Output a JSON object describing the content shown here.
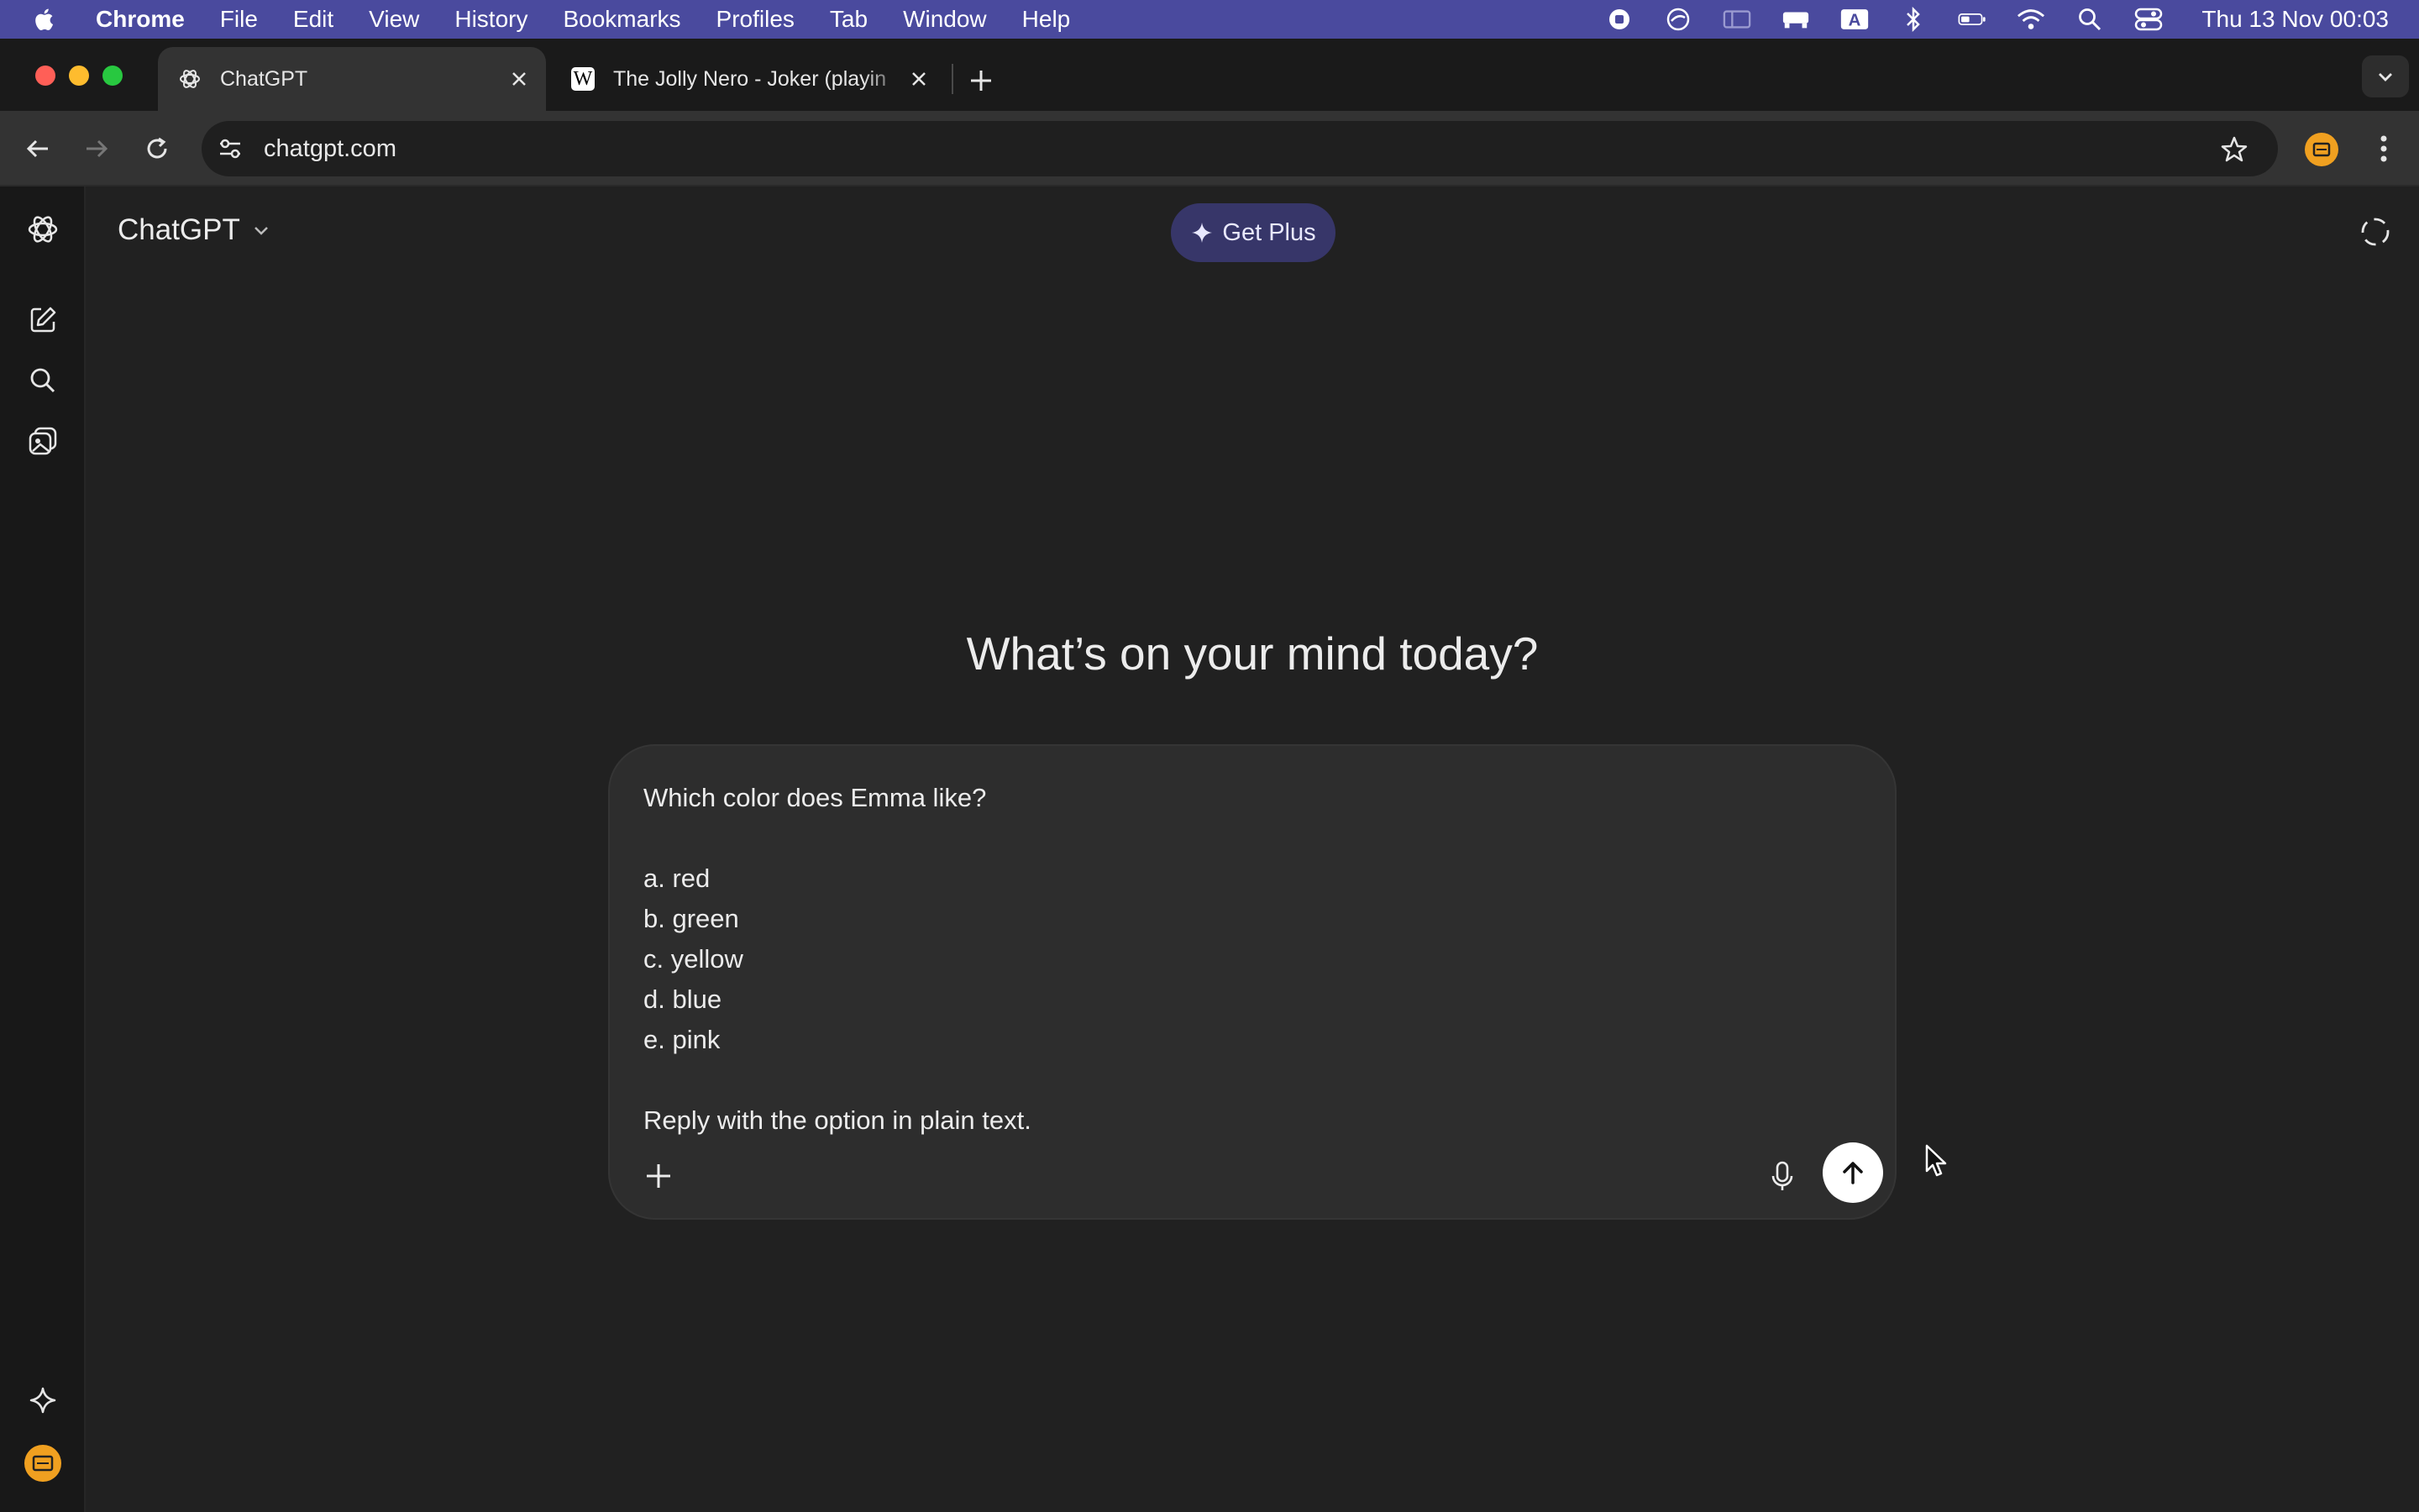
{
  "menubar": {
    "app_name": "Chrome",
    "items": [
      "File",
      "Edit",
      "View",
      "History",
      "Bookmarks",
      "Profiles",
      "Tab",
      "Window",
      "Help"
    ],
    "clock": "Thu 13 Nov  00:03",
    "status_icons": [
      "record-icon",
      "sync-icon",
      "sidecar-icon",
      "display-icon",
      "input-source-icon",
      "bluetooth-icon",
      "battery-icon",
      "wifi-icon",
      "spotlight-icon",
      "control-center-icon"
    ],
    "input_source": "A"
  },
  "tabs": [
    {
      "title": "ChatGPT",
      "icon": "chatgpt-icon",
      "active": true
    },
    {
      "title": "The Jolly Nero - Joker (playin",
      "icon": "wikipedia-icon",
      "favicon_letter": "W",
      "active": false
    }
  ],
  "address_bar": {
    "url": "chatgpt.com"
  },
  "colors": {
    "menubar": "#4a4a9e",
    "background": "#212121",
    "composer": "#2d2d2d",
    "get_plus_bg": "#373669",
    "extension": "#f0a020"
  },
  "header": {
    "model_name": "ChatGPT",
    "get_plus_label": "Get Plus"
  },
  "main": {
    "headline": "What’s on your mind today?",
    "prompt_text": "Which color does Emma like?\n\na. red\nb. green\nc. yellow\nd. blue\ne. pink\n\nReply with the option in plain text."
  }
}
